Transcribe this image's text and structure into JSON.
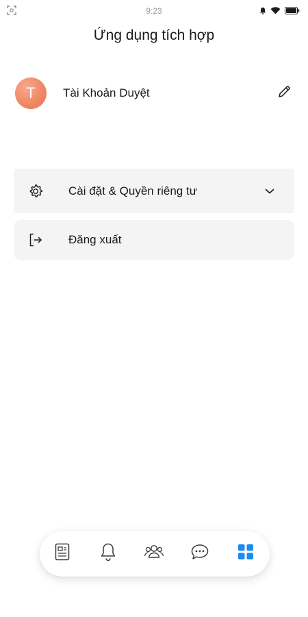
{
  "status_bar": {
    "time": "9:23",
    "icons": [
      "screenshot-icon",
      "alarm-icon",
      "wifi-icon",
      "battery-icon"
    ]
  },
  "header": {
    "title": "Ứng dụng tích hợp"
  },
  "profile": {
    "avatar_letter": "T",
    "name": "Tài Khoản Duyệt",
    "avatar_color": "#f08664",
    "edit_icon": "pencil-icon"
  },
  "menu": {
    "settings": {
      "icon": "gear-icon",
      "label": "Cài đặt & Quyền riêng tư",
      "expand_icon": "chevron-down-icon"
    },
    "logout": {
      "icon": "logout-icon",
      "label": "Đăng xuất"
    }
  },
  "bottom_nav": {
    "items": [
      {
        "icon": "news-icon",
        "active": false
      },
      {
        "icon": "bell-icon",
        "active": false
      },
      {
        "icon": "contacts-icon",
        "active": false
      },
      {
        "icon": "chat-icon",
        "active": false
      },
      {
        "icon": "apps-grid-icon",
        "active": true
      }
    ],
    "active_color": "#1a8cf0",
    "inactive_color": "#3a3a3a"
  },
  "colors": {
    "card_background": "#f4f4f4",
    "background": "#ffffff"
  }
}
